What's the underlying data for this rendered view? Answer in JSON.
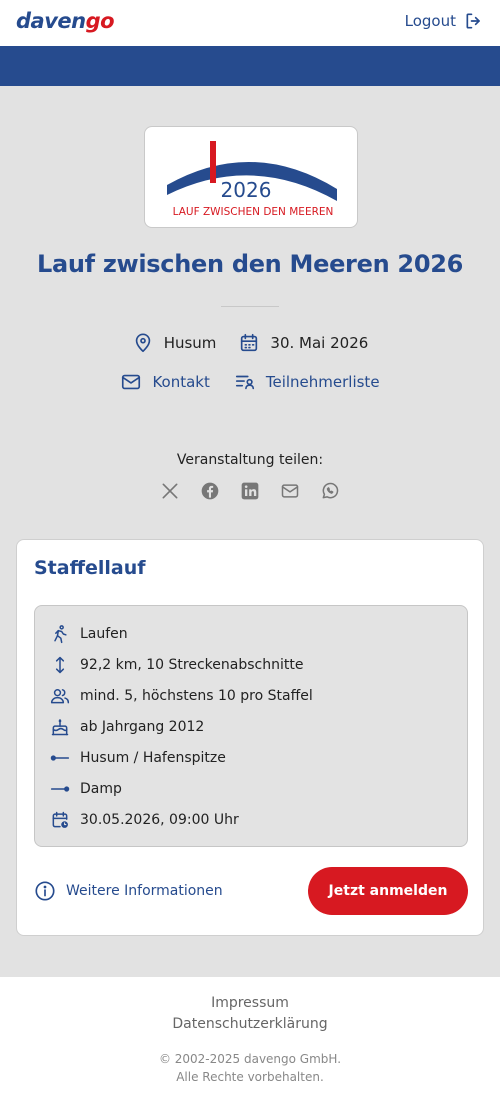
{
  "header": {
    "brand_part1": "daven",
    "brand_part2": "go",
    "logout_label": "Logout"
  },
  "event": {
    "logo_year": "2026",
    "logo_caption": "LAUF ZWISCHEN DEN MEEREN",
    "title": "Lauf zwischen den Meeren 2026",
    "location": "Husum",
    "date": "30. Mai 2026",
    "contact_label": "Kontakt",
    "participants_label": "Teilnehmerliste"
  },
  "share": {
    "label": "Veranstaltung teilen:",
    "icons": [
      "x-icon",
      "facebook-icon",
      "linkedin-icon",
      "mail-icon",
      "whatsapp-icon"
    ]
  },
  "competition": {
    "title": "Staffellauf",
    "details": {
      "discipline": "Laufen",
      "distance": "92,2 km, 10 Streckenabschnitte",
      "team_size": "mind. 5, höchstens 10 pro Staffel",
      "age": "ab Jahrgang 2012",
      "start": "Husum / Hafenspitze",
      "finish": "Damp",
      "datetime": "30.05.2026, 09:00 Uhr"
    },
    "more_info_label": "Weitere Informationen",
    "register_label": "Jetzt anmelden"
  },
  "footer": {
    "imprint": "Impressum",
    "privacy": "Datenschutzerklärung",
    "copyright": "© 2002-2025 davengo GmbH.",
    "rights": "Alle Rechte vorbehalten."
  },
  "colors": {
    "primary": "#264b8e",
    "accent": "#d71921",
    "background": "#e2e2e2"
  }
}
